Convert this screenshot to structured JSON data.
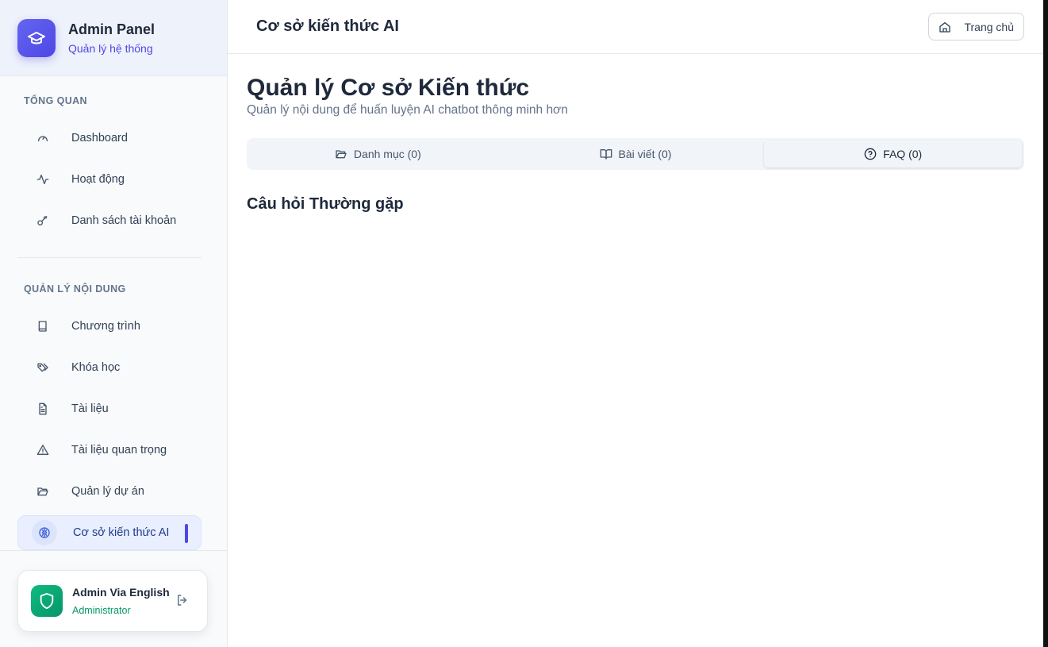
{
  "brand": {
    "title": "Admin Panel",
    "subtitle": "Quản lý hệ thống",
    "logo_icon": "graduation-cap-icon",
    "accent_color": "#4f46e5"
  },
  "sidebar": {
    "sections": [
      {
        "label": "TỔNG QUAN",
        "items": [
          {
            "label": "Dashboard",
            "icon": "gauge-icon"
          },
          {
            "label": "Hoạt động",
            "icon": "activity-icon"
          },
          {
            "label": "Danh sách tài khoản",
            "icon": "key-icon"
          }
        ]
      },
      {
        "label": "QUẢN LÝ NỘI DUNG",
        "items": [
          {
            "label": "Chương trình",
            "icon": "book-icon"
          },
          {
            "label": "Khóa học",
            "icon": "tags-icon"
          },
          {
            "label": "Tài liệu",
            "icon": "file-text-icon"
          },
          {
            "label": "Tài liệu quan trọng",
            "icon": "alert-triangle-icon"
          },
          {
            "label": "Quản lý dự án",
            "icon": "folder-open-icon"
          },
          {
            "label": "Cơ sở kiến thức AI",
            "icon": "brain-icon",
            "active": true
          }
        ]
      }
    ]
  },
  "user": {
    "name": "Admin Via English",
    "role": "Administrator",
    "avatar_icon": "shield-icon",
    "avatar_color": "#10b981"
  },
  "topbar": {
    "title": "Cơ sở kiến thức AI",
    "home_button": "Trang chủ"
  },
  "page": {
    "title": "Quản lý Cơ sở Kiến thức",
    "subtitle": "Quản lý nội dung để huấn luyện AI chatbot thông minh hơn",
    "tabs": [
      {
        "label": "Danh mục (0)",
        "icon": "folder-open-icon"
      },
      {
        "label": "Bài viết (0)",
        "icon": "book-open-icon"
      },
      {
        "label": "FAQ (0)",
        "icon": "help-circle-icon",
        "active": true
      }
    ],
    "section_title": "Câu hỏi Thường gặp"
  }
}
